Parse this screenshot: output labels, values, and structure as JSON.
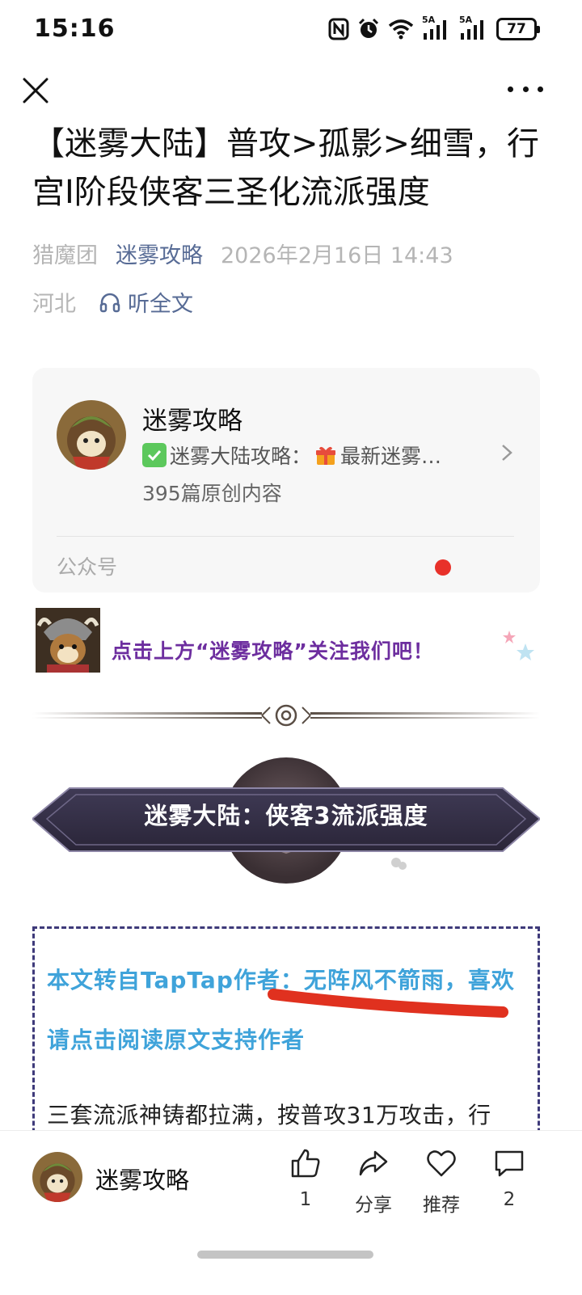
{
  "status_bar": {
    "time": "15:16",
    "battery": "77",
    "signal_1_label": "5A",
    "signal_2_label": "5A"
  },
  "article": {
    "title": "【迷雾大陆】普攻>孤影>细雪，行宫I阶段侠客三圣化流派强度",
    "author": "猎魔团",
    "account": "迷雾攻略",
    "date": "2026年2月16日 14:43",
    "location": "河北",
    "listen_label": "听全文"
  },
  "account_card": {
    "name": "迷雾攻略",
    "desc_prefix": "迷雾大陆攻略：",
    "desc_suffix": "最新迷雾…",
    "count": "395篇原创内容",
    "type": "公众号"
  },
  "follow_banner": {
    "text": "点击上方“迷雾攻略”关注我们吧！"
  },
  "section": {
    "title": "迷雾大陆：侠客3流派强度"
  },
  "quote": {
    "text": "本文转自TapTap作者：无阵风不箭雨，喜欢请点击阅读原文支持作者"
  },
  "body": {
    "first_line": "三套流派神铸都拉满，按普攻31万攻击，行"
  },
  "bottom_bar": {
    "account": "迷雾攻略",
    "like_count": "1",
    "share_label": "分享",
    "recommend_label": "推荐",
    "comment_count": "2"
  },
  "colors": {
    "link": "#576b95",
    "meta": "#b5b5b5",
    "follow_text": "#6d2e9f",
    "quote_text": "#3fa3da",
    "dashed_border": "#3e3a7a",
    "red_dot": "#e8312a"
  },
  "icons": [
    "close-icon",
    "more-icon",
    "headphones-icon",
    "chevron-right-icon",
    "check-icon",
    "gift-icon",
    "thumbs-up-icon",
    "share-icon",
    "heart-icon",
    "comment-icon",
    "nfc-icon",
    "alarm-icon",
    "wifi-icon",
    "signal-icon",
    "battery-icon"
  ]
}
